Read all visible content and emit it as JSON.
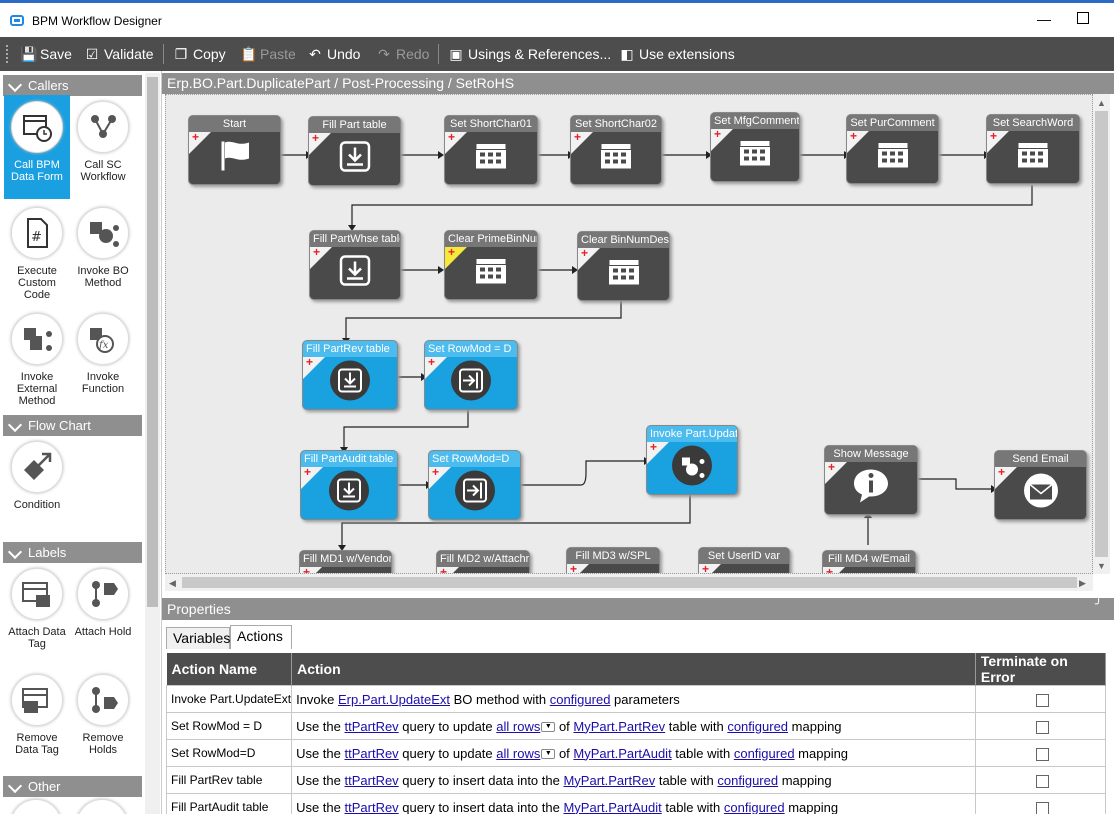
{
  "window": {
    "title": "BPM Workflow Designer"
  },
  "toolbar": {
    "save": "Save",
    "validate": "Validate",
    "copy": "Copy",
    "paste": "Paste",
    "undo": "Undo",
    "redo": "Redo",
    "usages": "Usings & References...",
    "use_extensions": "Use extensions"
  },
  "palette": {
    "sections": {
      "callers": "Callers",
      "flow_chart": "Flow Chart",
      "labels": "Labels",
      "other": "Other"
    },
    "items": {
      "call_bpm": "Call BPM Data Form",
      "call_sc": "Call SC Workflow",
      "exec_code": "Execute Custom Code",
      "invoke_bo": "Invoke BO Method",
      "invoke_ext": "Invoke External Method",
      "invoke_fn": "Invoke Function",
      "condition": "Condition",
      "attach_tag": "Attach Data Tag",
      "attach_hold": "Attach Hold",
      "remove_tag": "Remove Data Tag",
      "remove_holds": "Remove Holds"
    }
  },
  "breadcrumb": "Erp.BO.Part.DuplicatePart / Post-Processing / SetRoHS",
  "nodes": {
    "start": "Start",
    "fill_part": "Fill Part table",
    "sc01": "Set ShortChar01",
    "sc02": "Set ShortChar02",
    "mfg": "Set MfgComment",
    "pur": "Set PurComment",
    "search": "Set SearchWord",
    "whse": "Fill PartWhse table",
    "clr_prime": "Clear PrimeBinNum",
    "clr_bin": "Clear BinNumDesc",
    "partrev": "Fill PartRev table",
    "rowmod1": "Set RowMod = D",
    "audit": "Fill PartAudit table",
    "rowmod2": "Set RowMod=D",
    "invoke_upd": "Invoke Part.UpdateExt",
    "show_msg": "Show Message",
    "send_email": "Send Email",
    "md1": "Fill  MD1 w/Vendor",
    "md2": "Fill MD2 w/Attachr",
    "md3": "Fill MD3 w/SPL",
    "userid": "Set UserID var",
    "md4": "Fill MD4 w/Email"
  },
  "properties": {
    "title": "Properties",
    "tabs": [
      "Variables",
      "Actions"
    ],
    "columns": {
      "name": "Action Name",
      "action": "Action",
      "terminate": "Terminate on Error"
    },
    "rows": [
      {
        "name": "Invoke Part.UpdateExt",
        "p1": "Invoke ",
        "l1": "Erp.Part.UpdateExt",
        "p2": " BO method with ",
        "l2": "configured",
        "p3": " parameters"
      },
      {
        "name": "Set RowMod = D",
        "p1": "Use the ",
        "l1": "ttPartRev",
        "p2": " query to update ",
        "l2": "all rows",
        "p3": " of ",
        "l3": "MyPart.PartRev",
        "p4": " table with ",
        "l4": "configured",
        "p5": " mapping"
      },
      {
        "name": "Set RowMod=D",
        "p1": "Use the ",
        "l1": "ttPartRev",
        "p2": " query to update ",
        "l2": "all rows",
        "p3": " of ",
        "l3": "MyPart.PartAudit",
        "p4": " table with ",
        "l4": "configured",
        "p5": " mapping"
      },
      {
        "name": "Fill PartRev table",
        "p1": "Use the ",
        "l1": "ttPartRev",
        "p2": " query to insert data into the ",
        "l3": "MyPart.PartRev",
        "p4": " table with ",
        "l4": "configured",
        "p5": " mapping"
      },
      {
        "name": "Fill PartAudit table",
        "p1": "Use the ",
        "l1": "ttPartRev",
        "p2": " query to insert data into the ",
        "l3": "MyPart.PartAudit",
        "p4": " table with ",
        "l4": "configured",
        "p5": " mapping"
      }
    ]
  },
  "colors": {
    "accent": "#1aa2e0",
    "toolbar": "#4d4d4d",
    "node": "#4a4a4a",
    "header": "#8f8f8f",
    "titlebar_accent": "#2b6bc7"
  }
}
